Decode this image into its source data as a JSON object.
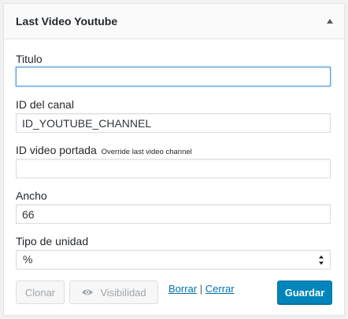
{
  "widget": {
    "title": "Last Video Youtube"
  },
  "fields": {
    "titulo": {
      "label": "Titulo",
      "value": ""
    },
    "id_canal": {
      "label": "ID del canal",
      "value": "ID_YOUTUBE_CHANNEL"
    },
    "id_video": {
      "label": "ID video portada",
      "hint": "Override last video channel",
      "value": ""
    },
    "ancho": {
      "label": "Ancho",
      "value": "66"
    },
    "tipo_unidad": {
      "label": "Tipo de unidad",
      "selected": "%"
    }
  },
  "actions": {
    "clone_label": "Clonar",
    "visibility_label": "Visibilidad",
    "delete_link": "Borrar",
    "separator": "|",
    "close_link": "Cerrar",
    "save_label": "Guardar"
  },
  "colors": {
    "primary": "#0085ba",
    "link": "#0073aa",
    "focus": "#5b9dd9"
  },
  "icons": {
    "toggle": "triangle-up-icon",
    "visibility": "eye-icon",
    "select": "select-arrows-icon"
  }
}
